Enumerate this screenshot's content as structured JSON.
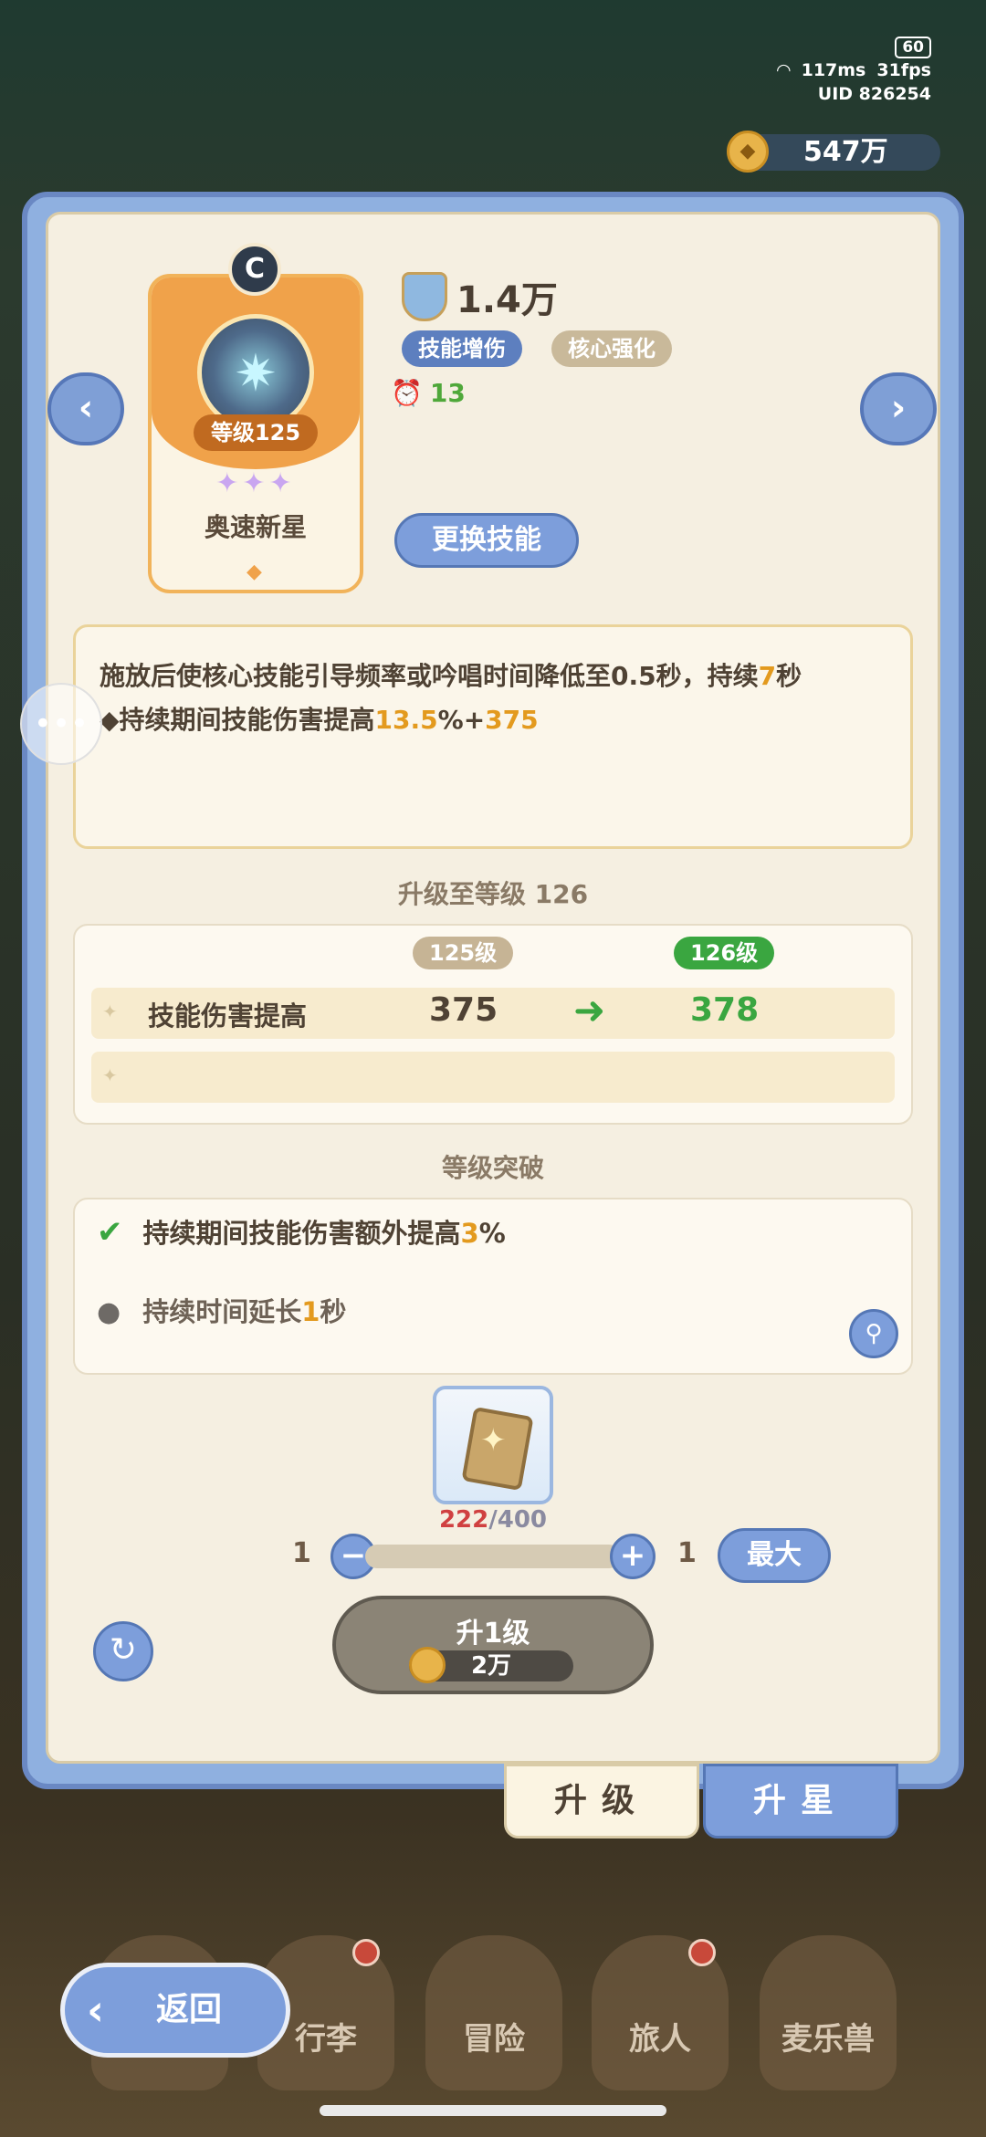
{
  "status": {
    "battery": "60",
    "ping": "117ms",
    "fps": "31fps",
    "uid": "UID 826254"
  },
  "currency": {
    "amount": "547万"
  },
  "card": {
    "emblem": "C",
    "level": "等级125",
    "stars": "✦✦✦",
    "name": "奥速新星"
  },
  "power": {
    "value": "1.4万"
  },
  "tags": [
    "技能增伤",
    "核心强化"
  ],
  "timer": {
    "value": "13"
  },
  "change_skill_label": "更换技能",
  "description": {
    "line1_a": "施放后使核心技能引导频率或吟唱时间降低至0.5秒，持续",
    "line1_b": "7",
    "line1_c": "秒",
    "line2_a": "◆持续期间技能伤害提高",
    "line2_b": "13.5",
    "line2_c": "%+",
    "line2_d": "375"
  },
  "upgrade": {
    "title": "升级至等级 126",
    "old_level": "125级",
    "new_level": "126级",
    "stat_name": "技能伤害提高",
    "old_value": "375",
    "new_value": "378"
  },
  "breakthrough": {
    "title": "等级突破",
    "item1_a": "持续期间技能伤害额外提高",
    "item1_b": "3",
    "item1_c": "%",
    "item2_a": "持续时间延长",
    "item2_b": "1",
    "item2_c": "秒"
  },
  "material": {
    "have": "222",
    "need": "/400"
  },
  "quantity": {
    "min": "1",
    "max": "1",
    "max_label": "最大"
  },
  "upgrade_button": {
    "label": "升1级",
    "cost": "2万"
  },
  "tabs": {
    "upgrade": "升级",
    "star": "升星"
  },
  "bottom_nav": {
    "back": "返回",
    "bag": "行李",
    "adventure": "冒险",
    "traveler": "旅人",
    "pets": "麦乐兽"
  }
}
